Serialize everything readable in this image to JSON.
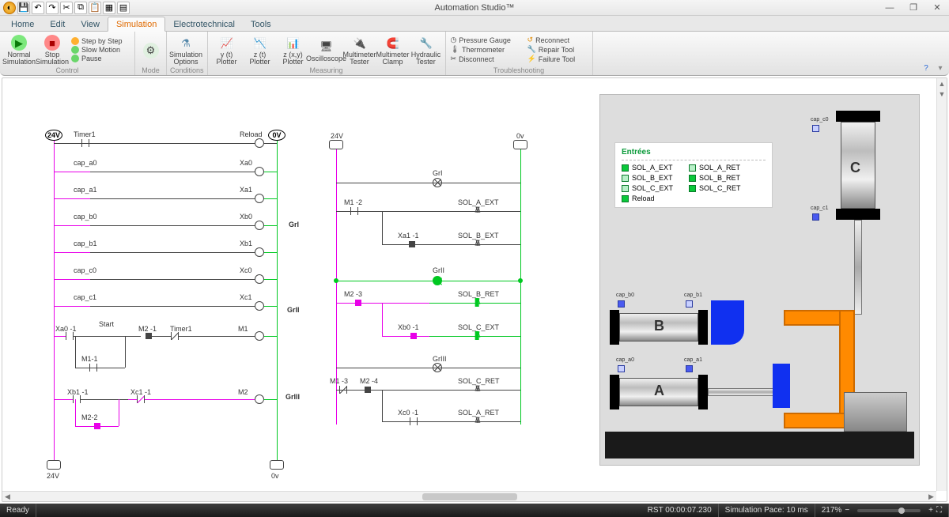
{
  "app": {
    "title": "Automation Studio™"
  },
  "window_buttons": {
    "min": "—",
    "max": "❐",
    "close": "✕"
  },
  "qat": [
    "app",
    "save",
    "undo",
    "redo",
    "cut",
    "copy",
    "paste",
    "grid1",
    "grid2"
  ],
  "tabs": {
    "items": [
      "Home",
      "Edit",
      "View",
      "Simulation",
      "Electrotechnical",
      "Tools"
    ],
    "active_index": 3
  },
  "ribbon": {
    "control": {
      "label": "Control",
      "normal": "Normal Simulation",
      "stop": "Stop Simulation",
      "step": "Step by Step",
      "slow": "Slow Motion",
      "pause": "Pause"
    },
    "mode": {
      "label": "Mode"
    },
    "conditions": {
      "label": "Conditions",
      "btn": "Simulation Options"
    },
    "measuring": {
      "label": "Measuring",
      "yt": "y (t) Plotter",
      "zt": "z (t) Plotter",
      "zxy": "z (x,y) Plotter",
      "oscilloscope": "Oscilloscope",
      "multimeter": "Multimeter Tester",
      "clamp": "Multimeter Clamp",
      "hydtester": "Hydraulic Tester"
    },
    "troubleshooting": {
      "label": "Troubleshooting",
      "pressure": "Pressure Gauge",
      "thermo": "Thermometer",
      "disconnect": "Disconnect",
      "reconnect": "Reconnect",
      "repair": "Repair Tool",
      "failure": "Failure Tool"
    }
  },
  "ladder_left": {
    "bus_left": "24V",
    "bus_right": "0V",
    "top_left": "Timer1",
    "top_right": "Reload",
    "rows": [
      {
        "l": "cap_a0",
        "r": "Xa0"
      },
      {
        "l": "cap_a1",
        "r": "Xa1"
      },
      {
        "l": "cap_b0",
        "r": "Xb0"
      },
      {
        "l": "cap_b1",
        "r": "Xb1"
      },
      {
        "l": "cap_c0",
        "r": "Xc0"
      },
      {
        "l": "cap_c1",
        "r": "Xc1"
      }
    ],
    "start_row": {
      "xa0": "Xa0 -1",
      "start": "Start",
      "m2": "M2 -1",
      "timer": "Timer1",
      "coil": "M1"
    },
    "m1_hold": "M1-1",
    "bottom_row": {
      "xb1": "Xb1 -1",
      "xc1": "Xc1 -1",
      "coil": "M2"
    },
    "m2_hold": "M2-2",
    "foot_left": "24V",
    "foot_right": "0v"
  },
  "ladder_right": {
    "bus_left": "24V",
    "bus_right": "0v",
    "grafcet": [
      "GrI",
      "GrII",
      "GrIII"
    ],
    "steps": [
      {
        "lamp": "GrI",
        "outputs": [
          {
            "c": "M1 -2",
            "o": "SOL_A_EXT"
          },
          {
            "c": "Xa1 -1",
            "o": "SOL_B_EXT"
          }
        ]
      },
      {
        "lamp": "GrII",
        "outputs": [
          {
            "c": "M2 -3",
            "o": "SOL_B_RET"
          },
          {
            "c": "Xb0 -1",
            "o": "SOL_C_EXT"
          }
        ]
      },
      {
        "lamp": "GrIII",
        "outputs": [
          {
            "c": "M1 -3",
            "c2": "M2 -4",
            "o": "SOL_C_RET"
          },
          {
            "c": "Xc0 -1",
            "o": "SOL_A_RET"
          }
        ]
      }
    ]
  },
  "machine": {
    "legend_title": "Entrées",
    "left_col": [
      "SOL_A_EXT",
      "SOL_B_EXT",
      "SOL_C_EXT",
      "Reload"
    ],
    "left_state": [
      "on",
      "off",
      "off",
      "on"
    ],
    "right_col": [
      "SOL_A_RET",
      "SOL_B_RET",
      "SOL_C_RET"
    ],
    "right_state": [
      "off",
      "on",
      "on"
    ],
    "sensors": {
      "cap_c0": "cap_c0",
      "cap_c1": "cap_c1",
      "cap_b0": "cap_b0",
      "cap_b1": "cap_b1",
      "cap_a0": "cap_a0",
      "cap_a1": "cap_a1"
    },
    "cyl_labels": {
      "a": "A",
      "b": "B",
      "c": "C"
    }
  },
  "status": {
    "ready": "Ready",
    "rst": "RST 00:00:07.230",
    "pace": "Simulation Pace: 10 ms",
    "zoom": "217%"
  }
}
